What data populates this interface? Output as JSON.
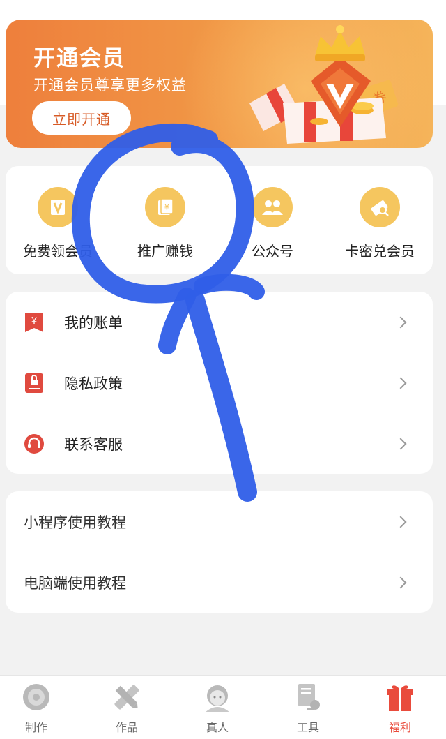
{
  "banner": {
    "title": "开通会员",
    "subtitle": "开通会员尊享更多权益",
    "button_label": "立即开通",
    "coupon_char": "券"
  },
  "quick_actions": [
    {
      "label": "免费领会员",
      "icon": "v-badge-icon"
    },
    {
      "label": "推广赚钱",
      "icon": "yuan-card-icon"
    },
    {
      "label": "公众号",
      "icon": "people-icon"
    },
    {
      "label": "卡密兑会员",
      "icon": "ticket-search-icon"
    }
  ],
  "menu": [
    {
      "label": "我的账单",
      "icon": "bill-icon"
    },
    {
      "label": "隐私政策",
      "icon": "privacy-lock-icon"
    },
    {
      "label": "联系客服",
      "icon": "customer-service-icon"
    }
  ],
  "tutorials": [
    {
      "label": "小程序使用教程"
    },
    {
      "label": "电脑端使用教程"
    }
  ],
  "tabs": [
    {
      "label": "制作",
      "icon": "disc-icon",
      "active": false
    },
    {
      "label": "作品",
      "icon": "pencil-ruler-icon",
      "active": false
    },
    {
      "label": "真人",
      "icon": "person-face-icon",
      "active": false
    },
    {
      "label": "工具",
      "icon": "document-wrench-icon",
      "active": false
    },
    {
      "label": "福利",
      "icon": "gift-icon",
      "active": true
    }
  ],
  "colors": {
    "brand_orange": "#ee7f3c",
    "icon_yellow": "#f5c65f",
    "menu_red": "#e04a3f",
    "active_tab": "#e94b3c",
    "marker_blue": "#2f5ee8"
  }
}
